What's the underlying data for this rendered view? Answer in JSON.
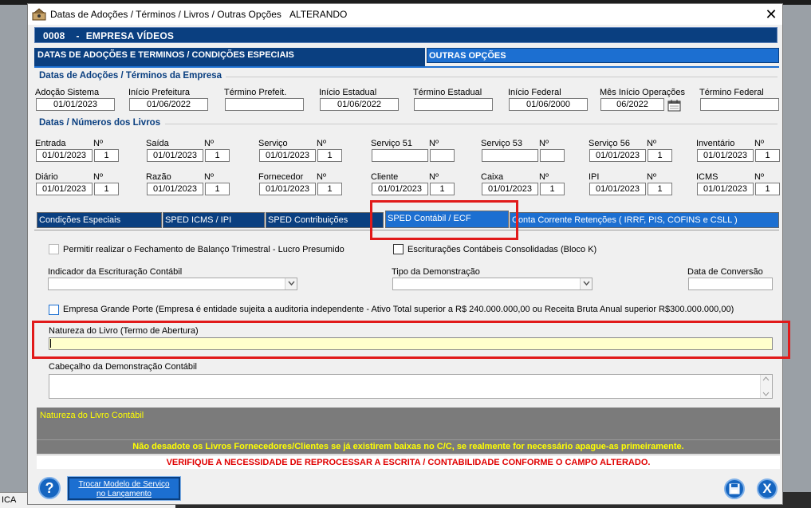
{
  "window": {
    "title": "Datas de Adoções / Términos / Livros / Outras Opções",
    "mode": "ALTERANDO",
    "close": "✕"
  },
  "company": {
    "code": "0008",
    "sep": "-",
    "name": "EMPRESA VÍDEOS"
  },
  "main_tabs": {
    "active": "DATAS DE ADOÇÕES E TERMINOS / CONDIÇÕES ESPECIAIS",
    "other": "OUTRAS OPÇÕES"
  },
  "sections": {
    "adoptions": "Datas de Adoções / Términos da Empresa",
    "books": "Datas / Números dos Livros"
  },
  "adoption_fields": [
    {
      "label": "Adoção Sistema",
      "value": "01/01/2023"
    },
    {
      "label": "Início Prefeitura",
      "value": "01/06/2022"
    },
    {
      "label": "Término Prefeit.",
      "value": ""
    },
    {
      "label": "Início Estadual",
      "value": "01/06/2022"
    },
    {
      "label": "Término Estadual",
      "value": ""
    },
    {
      "label": "Início Federal",
      "value": "01/06/2000"
    },
    {
      "label": "Mês Início Operações",
      "value": "06/2022"
    },
    {
      "label": "Término Federal",
      "value": ""
    }
  ],
  "books_row1": [
    {
      "label": "Entrada",
      "date": "01/01/2023",
      "n": "1"
    },
    {
      "label": "Saída",
      "date": "01/01/2023",
      "n": "1"
    },
    {
      "label": "Serviço",
      "date": "01/01/2023",
      "n": "1"
    },
    {
      "label": "Serviço 51",
      "date": "",
      "n": ""
    },
    {
      "label": "Serviço 53",
      "date": "",
      "n": ""
    },
    {
      "label": "Serviço 56",
      "date": "01/01/2023",
      "n": "1"
    },
    {
      "label": "Inventário",
      "date": "01/01/2023",
      "n": "1"
    }
  ],
  "books_row2": [
    {
      "label": "Diário",
      "date": "01/01/2023",
      "n": "1"
    },
    {
      "label": "Razão",
      "date": "01/01/2023",
      "n": "1"
    },
    {
      "label": "Fornecedor",
      "date": "01/01/2023",
      "n": "1"
    },
    {
      "label": "Cliente",
      "date": "01/01/2023",
      "n": "1"
    },
    {
      "label": "Caixa",
      "date": "01/01/2023",
      "n": "1"
    },
    {
      "label": "IPI",
      "date": "01/01/2023",
      "n": "1"
    },
    {
      "label": "ICMS",
      "date": "01/01/2023",
      "n": "1"
    }
  ],
  "n_label": "Nº",
  "inner_tabs": [
    "Condições Especiais",
    "SPED ICMS / IPI",
    "SPED Contribuições",
    "SPED Contábil / ECF",
    "Conta Corrente Retenções ( IRRF, PIS, COFINS  e  CSLL )"
  ],
  "ecf": {
    "chk_balanco": "Permitir realizar o Fechamento de Balanço Trimestral - Lucro Presumido",
    "chk_consolidadas": "Escriturações Contábeis Consolidadas (Bloco K)",
    "indicador_label": "Indicador da Escrituração Contábil",
    "tipo_label": "Tipo da Demonstração",
    "data_conv_label": "Data de Conversão",
    "chk_grande_porte": "Empresa Grande Porte (Empresa é entidade sujeita a auditoria independente - Ativo Total superior a R$ 240.000.000,00 ou Receita Bruta Anual superior R$300.000.000,00)",
    "natureza_label": "Natureza do Livro (Termo de Abertura)",
    "natureza_value": "",
    "cabecalho_label": "Cabeçalho da Demonstração Contábil"
  },
  "info": {
    "natureza_livro": "Natureza do Livro Contábil",
    "warning1": "Não desadote os Livros Fornecedores/Clientes se já existirem baixas no C/C, se realmente for necessário apague-as primeiramente.",
    "warning2": "VERIFIQUE A NECESSIDADE DE REPROCESSAR A ESCRITA / CONTABILIDADE CONFORME O CAMPO ALTERADO."
  },
  "buttons": {
    "help": "?",
    "trocar_line1": "Trocar Modelo de Serviço",
    "trocar_line2": "no Lançamento",
    "exit": "X"
  },
  "taskbar": {
    "text": "ICA"
  }
}
